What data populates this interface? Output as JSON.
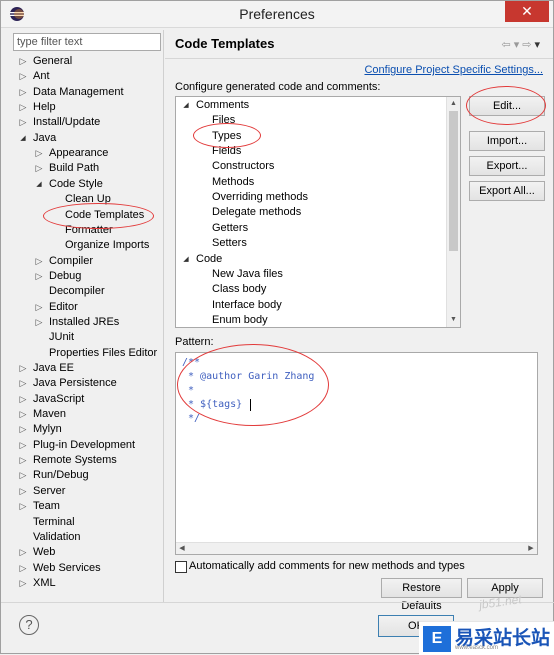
{
  "window": {
    "title": "Preferences",
    "close_glyph": "✕"
  },
  "left": {
    "filter_placeholder": "type filter text",
    "tree": [
      {
        "label": "General",
        "level": 0,
        "state": "collapsed"
      },
      {
        "label": "Ant",
        "level": 0,
        "state": "collapsed"
      },
      {
        "label": "Data Management",
        "level": 0,
        "state": "collapsed"
      },
      {
        "label": "Help",
        "level": 0,
        "state": "collapsed"
      },
      {
        "label": "Install/Update",
        "level": 0,
        "state": "collapsed"
      },
      {
        "label": "Java",
        "level": 0,
        "state": "expanded"
      },
      {
        "label": "Appearance",
        "level": 1,
        "state": "collapsed"
      },
      {
        "label": "Build Path",
        "level": 1,
        "state": "collapsed"
      },
      {
        "label": "Code Style",
        "level": 1,
        "state": "expanded"
      },
      {
        "label": "Clean Up",
        "level": 2,
        "state": "leaf"
      },
      {
        "label": "Code Templates",
        "level": 2,
        "state": "leaf",
        "selected": true
      },
      {
        "label": "Formatter",
        "level": 2,
        "state": "leaf"
      },
      {
        "label": "Organize Imports",
        "level": 2,
        "state": "leaf"
      },
      {
        "label": "Compiler",
        "level": 1,
        "state": "collapsed"
      },
      {
        "label": "Debug",
        "level": 1,
        "state": "collapsed"
      },
      {
        "label": "Decompiler",
        "level": 1,
        "state": "leaf"
      },
      {
        "label": "Editor",
        "level": 1,
        "state": "collapsed"
      },
      {
        "label": "Installed JREs",
        "level": 1,
        "state": "collapsed"
      },
      {
        "label": "JUnit",
        "level": 1,
        "state": "leaf"
      },
      {
        "label": "Properties Files Editor",
        "level": 1,
        "state": "leaf"
      },
      {
        "label": "Java EE",
        "level": 0,
        "state": "collapsed"
      },
      {
        "label": "Java Persistence",
        "level": 0,
        "state": "collapsed"
      },
      {
        "label": "JavaScript",
        "level": 0,
        "state": "collapsed"
      },
      {
        "label": "Maven",
        "level": 0,
        "state": "collapsed"
      },
      {
        "label": "Mylyn",
        "level": 0,
        "state": "collapsed"
      },
      {
        "label": "Plug-in Development",
        "level": 0,
        "state": "collapsed"
      },
      {
        "label": "Remote Systems",
        "level": 0,
        "state": "collapsed"
      },
      {
        "label": "Run/Debug",
        "level": 0,
        "state": "collapsed"
      },
      {
        "label": "Server",
        "level": 0,
        "state": "collapsed"
      },
      {
        "label": "Team",
        "level": 0,
        "state": "collapsed"
      },
      {
        "label": "Terminal",
        "level": 0,
        "state": "leaf"
      },
      {
        "label": "Validation",
        "level": 0,
        "state": "leaf"
      },
      {
        "label": "Web",
        "level": 0,
        "state": "collapsed"
      },
      {
        "label": "Web Services",
        "level": 0,
        "state": "collapsed"
      },
      {
        "label": "XML",
        "level": 0,
        "state": "collapsed"
      }
    ]
  },
  "page": {
    "title": "Code Templates",
    "project_link": "Configure Project Specific Settings...",
    "configure_label": "Configure generated code and comments:",
    "templates": [
      {
        "label": "Comments",
        "level": 0,
        "state": "expanded"
      },
      {
        "label": "Files",
        "level": 1,
        "state": "leaf"
      },
      {
        "label": "Types",
        "level": 1,
        "state": "leaf",
        "selected": true
      },
      {
        "label": "Fields",
        "level": 1,
        "state": "leaf"
      },
      {
        "label": "Constructors",
        "level": 1,
        "state": "leaf"
      },
      {
        "label": "Methods",
        "level": 1,
        "state": "leaf"
      },
      {
        "label": "Overriding methods",
        "level": 1,
        "state": "leaf"
      },
      {
        "label": "Delegate methods",
        "level": 1,
        "state": "leaf"
      },
      {
        "label": "Getters",
        "level": 1,
        "state": "leaf"
      },
      {
        "label": "Setters",
        "level": 1,
        "state": "leaf"
      },
      {
        "label": "Code",
        "level": 0,
        "state": "expanded"
      },
      {
        "label": "New Java files",
        "level": 1,
        "state": "leaf"
      },
      {
        "label": "Class body",
        "level": 1,
        "state": "leaf"
      },
      {
        "label": "Interface body",
        "level": 1,
        "state": "leaf"
      },
      {
        "label": "Enum body",
        "level": 1,
        "state": "leaf"
      }
    ],
    "buttons": {
      "edit": "Edit...",
      "import": "Import...",
      "export": "Export...",
      "export_all": "Export All..."
    },
    "pattern_label": "Pattern:",
    "pattern_lines": [
      "/**",
      " * @author Garin Zhang",
      " *",
      " * ${tags}",
      " */"
    ],
    "auto_comments_label": "Automatically add comments for new methods and types",
    "auto_comments_checked": false,
    "restore_defaults": "Restore Defaults",
    "apply": "Apply"
  },
  "footer": {
    "ok": "OK",
    "help_glyph": "?"
  },
  "watermark": {
    "brand": "易采站长站",
    "sub": "www.easck.com",
    "url": "jb51.net"
  },
  "colors": {
    "annotation": "#e23b3b",
    "selection": "#3399ff",
    "link": "#0b4fb0"
  }
}
